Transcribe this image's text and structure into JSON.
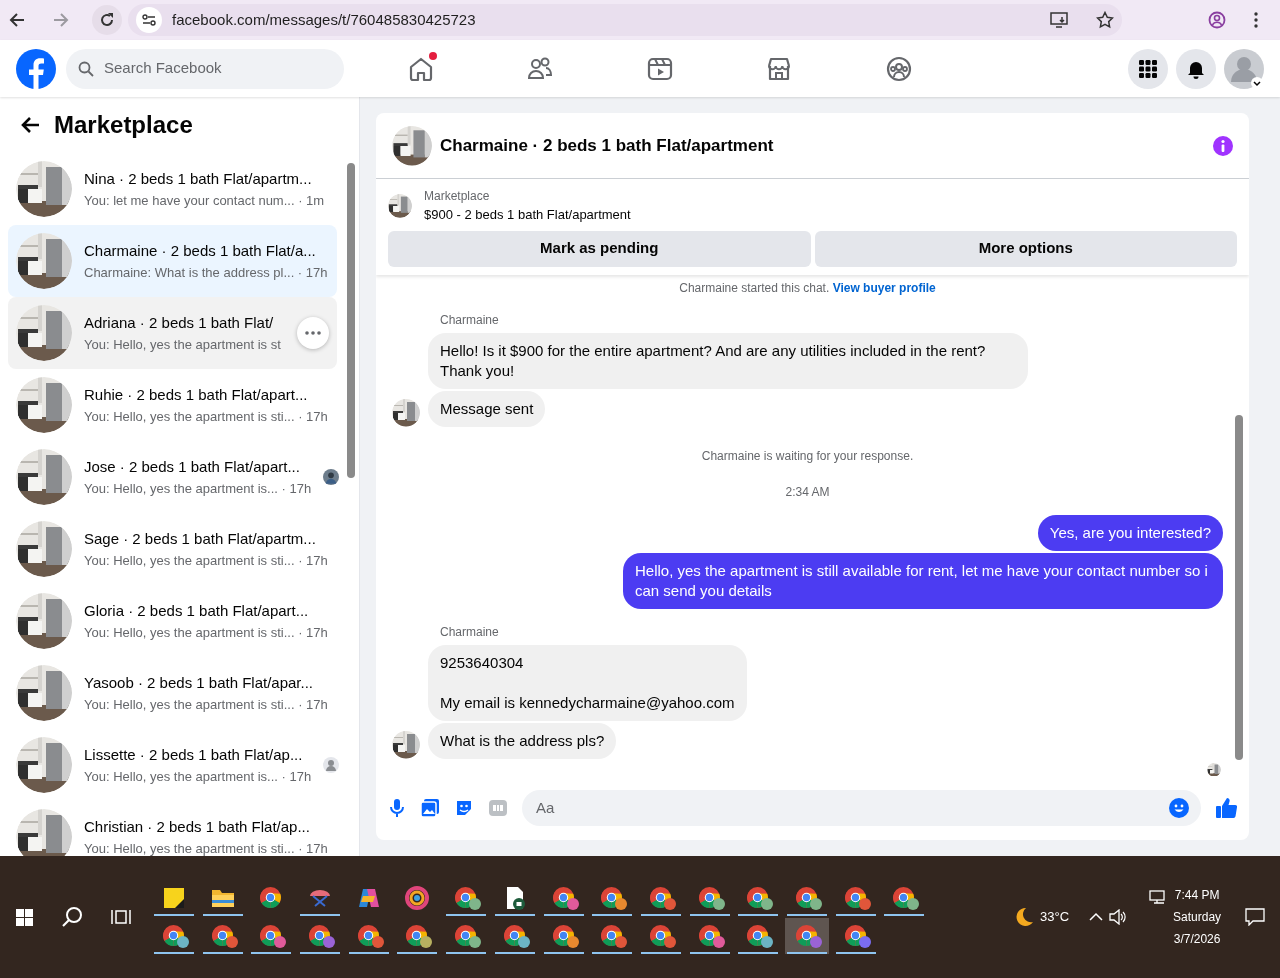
{
  "browser": {
    "url": "facebook.com/messages/t/760485830425723",
    "forward_disabled": true
  },
  "header": {
    "search_placeholder": "Search Facebook",
    "nav": [
      {
        "kind": "home",
        "dot": true
      },
      {
        "kind": "friends",
        "dot": false
      },
      {
        "kind": "video",
        "dot": false
      },
      {
        "kind": "marketplace",
        "dot": false
      },
      {
        "kind": "groups",
        "dot": false
      }
    ]
  },
  "sidebar": {
    "title": "Marketplace",
    "conversations": [
      {
        "kind": "plain",
        "title": "Nina · 2 beds 1 bath Flat/apartm...",
        "preview": "You: let me have your contact num... · 1m",
        "selected": false,
        "hovered": false
      },
      {
        "kind": "plain",
        "title": "Charmaine · 2 beds 1 bath Flat/a...",
        "preview": "Charmaine: What is the address pl... · 17h",
        "selected": true,
        "hovered": false
      },
      {
        "kind": "plain",
        "title": "Adriana · 2 beds 1 bath Flat/",
        "preview": "You: Hello, yes the apartment is st",
        "selected": false,
        "hovered": true
      },
      {
        "kind": "plain",
        "title": "Ruhie · 2 beds 1 bath Flat/apart...",
        "preview": "You: Hello, yes the apartment is sti... · 17h",
        "selected": false,
        "hovered": false
      },
      {
        "title": "Jose · 2 beds 1 bath Flat/apart...",
        "preview": "You: Hello, yes the apartment is... · 17h",
        "selected": false,
        "hovered": false
      },
      {
        "kind": "plain",
        "title": "Sage · 2 beds 1 bath Flat/apartm...",
        "preview": "You: Hello, yes the apartment is sti... · 17h",
        "selected": false,
        "hovered": false
      },
      {
        "kind": "plain",
        "title": "Gloria · 2 beds 1 bath Flat/apart...",
        "preview": "You: Hello, yes the apartment is sti... · 17h",
        "selected": false,
        "hovered": false
      },
      {
        "kind": "plain",
        "title": "Yasoob · 2 beds 1 bath Flat/apar...",
        "preview": "You: Hello, yes the apartment is sti... · 17h",
        "selected": false,
        "hovered": false
      },
      {
        "kind": "generic",
        "title": "Lissette · 2 beds 1 bath Flat/ap...",
        "preview": "You: Hello, yes the apartment is... · 17h",
        "selected": false,
        "hovered": false
      },
      {
        "kind": "plain",
        "title": "Christian · 2 beds 1 bath Flat/ap...",
        "preview": "You: Hello, yes the apartment is sti... · 17h",
        "selected": false,
        "hovered": false
      }
    ]
  },
  "chat": {
    "title": "Charmaine · 2 beds 1 bath Flat/apartment",
    "listing_label": "Marketplace",
    "listing": "$900 - 2 beds 1 bath Flat/apartment",
    "buttons": [
      "Mark as pending",
      "More options"
    ],
    "messages": [
      {
        "kind": "notice",
        "text": "Charmaine started this chat.",
        "link": "View buyer profile"
      },
      {
        "kind": "incoming",
        "sender": "Charmaine",
        "bubbles": [
          "Hello!  Is it $900 for the entire apartment? And are any utilities included in the rent? Thank you!",
          "Message sent"
        ]
      },
      {
        "kind": "notice",
        "text": "Charmaine is waiting for your response."
      },
      {
        "kind": "timestamp",
        "text": "2:34 AM"
      },
      {
        "kind": "outgoing",
        "bubbles": [
          "Yes, are you interested?",
          "Hello, yes the apartment is still available for rent, let me have your contact number so i can send you details"
        ]
      },
      {
        "kind": "incoming",
        "sender": "Charmaine",
        "bubbles": [
          "9253640304\n\nMy email is kennedycharmaine@yahoo.com",
          "What is the address pls?"
        ]
      }
    ],
    "composer_placeholder": "Aa"
  },
  "taskbar": {
    "rows": [
      [
        {
          "kind": "sticky",
          "running": true
        },
        {
          "kind": "folder",
          "running": true
        },
        {
          "kind": "chrome",
          "running": false
        },
        {
          "kind": "snip",
          "running": true
        },
        {
          "kind": "copilot",
          "running": false
        },
        {
          "kind": "photos",
          "running": false
        },
        {
          "kind": "chrome",
          "color": "#7fb58a",
          "running": true
        },
        {
          "kind": "document",
          "running": true
        },
        {
          "kind": "chrome",
          "color": "#e05a9a",
          "running": true
        },
        {
          "kind": "chrome",
          "color": "#e8892f",
          "running": true
        },
        {
          "kind": "chrome",
          "color": "#e0563a",
          "running": true
        },
        {
          "kind": "chrome",
          "color": "#7fb58a",
          "running": true
        },
        {
          "kind": "chrome",
          "color": "#7fb58a",
          "running": true
        },
        {
          "kind": "chrome",
          "color": "#7fb58a",
          "running": true
        },
        {
          "kind": "chrome",
          "color": "#e0563a",
          "running": true
        },
        {
          "kind": "chrome",
          "color": "#7fb58a",
          "running": true
        }
      ],
      [
        {
          "kind": "chrome",
          "color": "#6cb4c4",
          "running": true
        },
        {
          "kind": "chrome",
          "color": "#e0563a",
          "running": true
        },
        {
          "kind": "chrome",
          "color": "#e05a9a",
          "running": true
        },
        {
          "kind": "chrome",
          "color": "#9a63d6",
          "running": true
        },
        {
          "kind": "chrome",
          "color": "#e0563a",
          "running": true
        },
        {
          "kind": "chrome",
          "color": "#b8b060",
          "running": true
        },
        {
          "kind": "chrome",
          "color": "#7fb58a",
          "running": true
        },
        {
          "kind": "chrome",
          "color": "#6cb4c4",
          "running": true
        },
        {
          "kind": "chrome",
          "color": "#e8892f",
          "running": true
        },
        {
          "kind": "chrome",
          "color": "#e0563a",
          "running": true
        },
        {
          "kind": "chrome",
          "color": "#e0563a",
          "running": true
        },
        {
          "kind": "chrome",
          "color": "#e05a9a",
          "running": true
        },
        {
          "kind": "chrome",
          "color": "#6cb4c4",
          "running": true
        },
        {
          "kind": "chrome",
          "color": "#9a63d6",
          "running": true,
          "active": true
        },
        {
          "kind": "chrome",
          "color": "#7a6cf0",
          "running": true
        }
      ]
    ],
    "weather": "33°C",
    "time": "7:44 PM",
    "day": "Saturday",
    "date": "3/7/2026"
  }
}
